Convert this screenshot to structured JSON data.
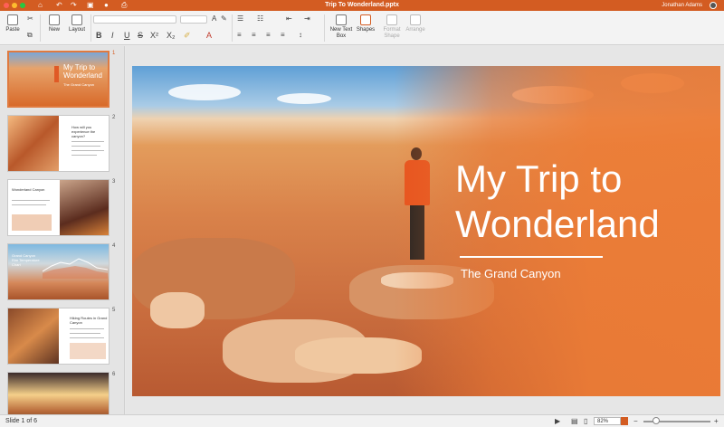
{
  "window": {
    "title": "Trip To Wonderland.pptx",
    "user_name": "Jonathan Adams",
    "accent": "#d35c22"
  },
  "ribbon": {
    "paste_label": "Paste",
    "new_label": "New",
    "layout_label": "Layout",
    "new_text_box_label": "New Text\nBox",
    "shapes_label": "Shapes",
    "format_shape_label": "Format\nShape",
    "arrange_label": "Arrange",
    "bold": "B",
    "italic": "I",
    "underline": "U",
    "strike": "S",
    "superscript": "X²",
    "subscript": "X₂"
  },
  "slides": [
    {
      "number": "1",
      "title": "My Trip to Wonderland",
      "subtitle": "The Grand Canyon"
    },
    {
      "number": "2",
      "title": "How will you experience the canyon?"
    },
    {
      "number": "3",
      "title": "Wonderland Canyon"
    },
    {
      "number": "4",
      "title": "Grand Canyon Rim Temperature Chart"
    },
    {
      "number": "5",
      "title": "Hiking Routes in Grand Canyon"
    },
    {
      "number": "6"
    }
  ],
  "main_slide": {
    "title_line1": "My Trip to",
    "title_line2": "Wonderland",
    "subtitle": "The Grand Canyon"
  },
  "status": {
    "slide_indicator": "Slide 1 of 6",
    "zoom": "82%"
  }
}
